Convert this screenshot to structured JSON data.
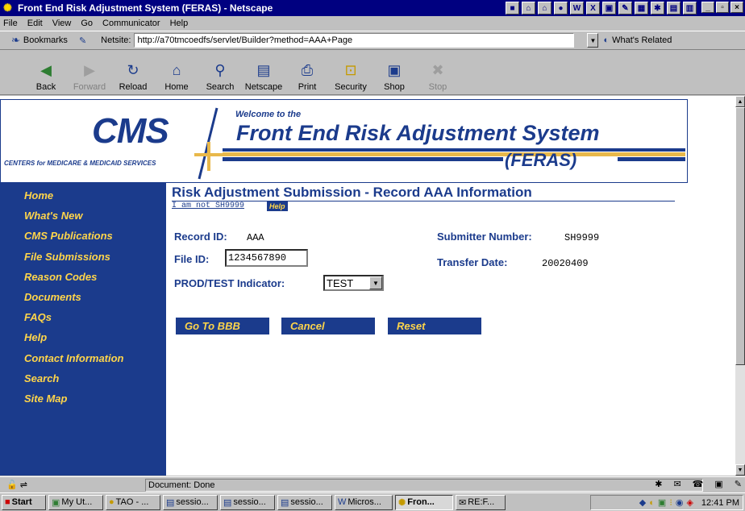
{
  "window": {
    "title": "Front End Risk Adjustment System (FERAS) - Netscape"
  },
  "menu": [
    "File",
    "Edit",
    "View",
    "Go",
    "Communicator",
    "Help"
  ],
  "location": {
    "bookmarks_label": "Bookmarks",
    "netsite_label": "Netsite:",
    "url": "http://a70tmcoedfs/servlet/Builder?method=AAA+Page",
    "related_label": "What's Related"
  },
  "toolbar": [
    {
      "label": "Back",
      "icon": "back-arrow-icon",
      "enabled": true
    },
    {
      "label": "Forward",
      "icon": "forward-arrow-icon",
      "enabled": false
    },
    {
      "label": "Reload",
      "icon": "reload-icon",
      "enabled": true
    },
    {
      "label": "Home",
      "icon": "home-icon",
      "enabled": true
    },
    {
      "label": "Search",
      "icon": "search-icon",
      "enabled": true
    },
    {
      "label": "Netscape",
      "icon": "netscape-icon",
      "enabled": true
    },
    {
      "label": "Print",
      "icon": "print-icon",
      "enabled": true
    },
    {
      "label": "Security",
      "icon": "security-lock-icon",
      "enabled": true
    },
    {
      "label": "Shop",
      "icon": "shop-icon",
      "enabled": true
    },
    {
      "label": "Stop",
      "icon": "stop-icon",
      "enabled": false
    }
  ],
  "banner": {
    "logo": "CMS",
    "logo_sub": "CENTERS for MEDICARE & MEDICAID SERVICES",
    "welcome": "Welcome to the",
    "title": "Front End Risk Adjustment System",
    "abbr": "(FERAS)"
  },
  "nav": [
    "Home",
    "What's New",
    "CMS Publications",
    "File Submissions",
    "Reason Codes",
    "Documents",
    "FAQs",
    "Help",
    "Contact Information",
    "Search",
    "Site Map"
  ],
  "page": {
    "title": "Risk Adjustment Submission - Record AAA Information",
    "not_user_link": "I am not SH9999",
    "help_badge": "Help",
    "record_id_label": "Record ID:",
    "record_id_value": "AAA",
    "file_id_label": "File ID:",
    "file_id_value": "1234567890",
    "prod_test_label": "PROD/TEST Indicator:",
    "prod_test_value": "TEST",
    "submitter_label": "Submitter Number:",
    "submitter_value": "SH9999",
    "transfer_label": "Transfer Date:",
    "transfer_value": "20020409",
    "buttons": [
      "Go To BBB",
      "Cancel",
      "Reset"
    ]
  },
  "status": {
    "text": "Document: Done"
  },
  "taskbar": {
    "start": "Start",
    "items": [
      "My Ut...",
      "TAO - ...",
      "sessio...",
      "sessio...",
      "sessio...",
      "Micros...",
      "Fron...",
      "RE:F..."
    ],
    "clock": "12:41 PM"
  },
  "colors": {
    "navy": "#1b3b8c",
    "gold": "#ffd54a",
    "title_bar": "#000080"
  }
}
